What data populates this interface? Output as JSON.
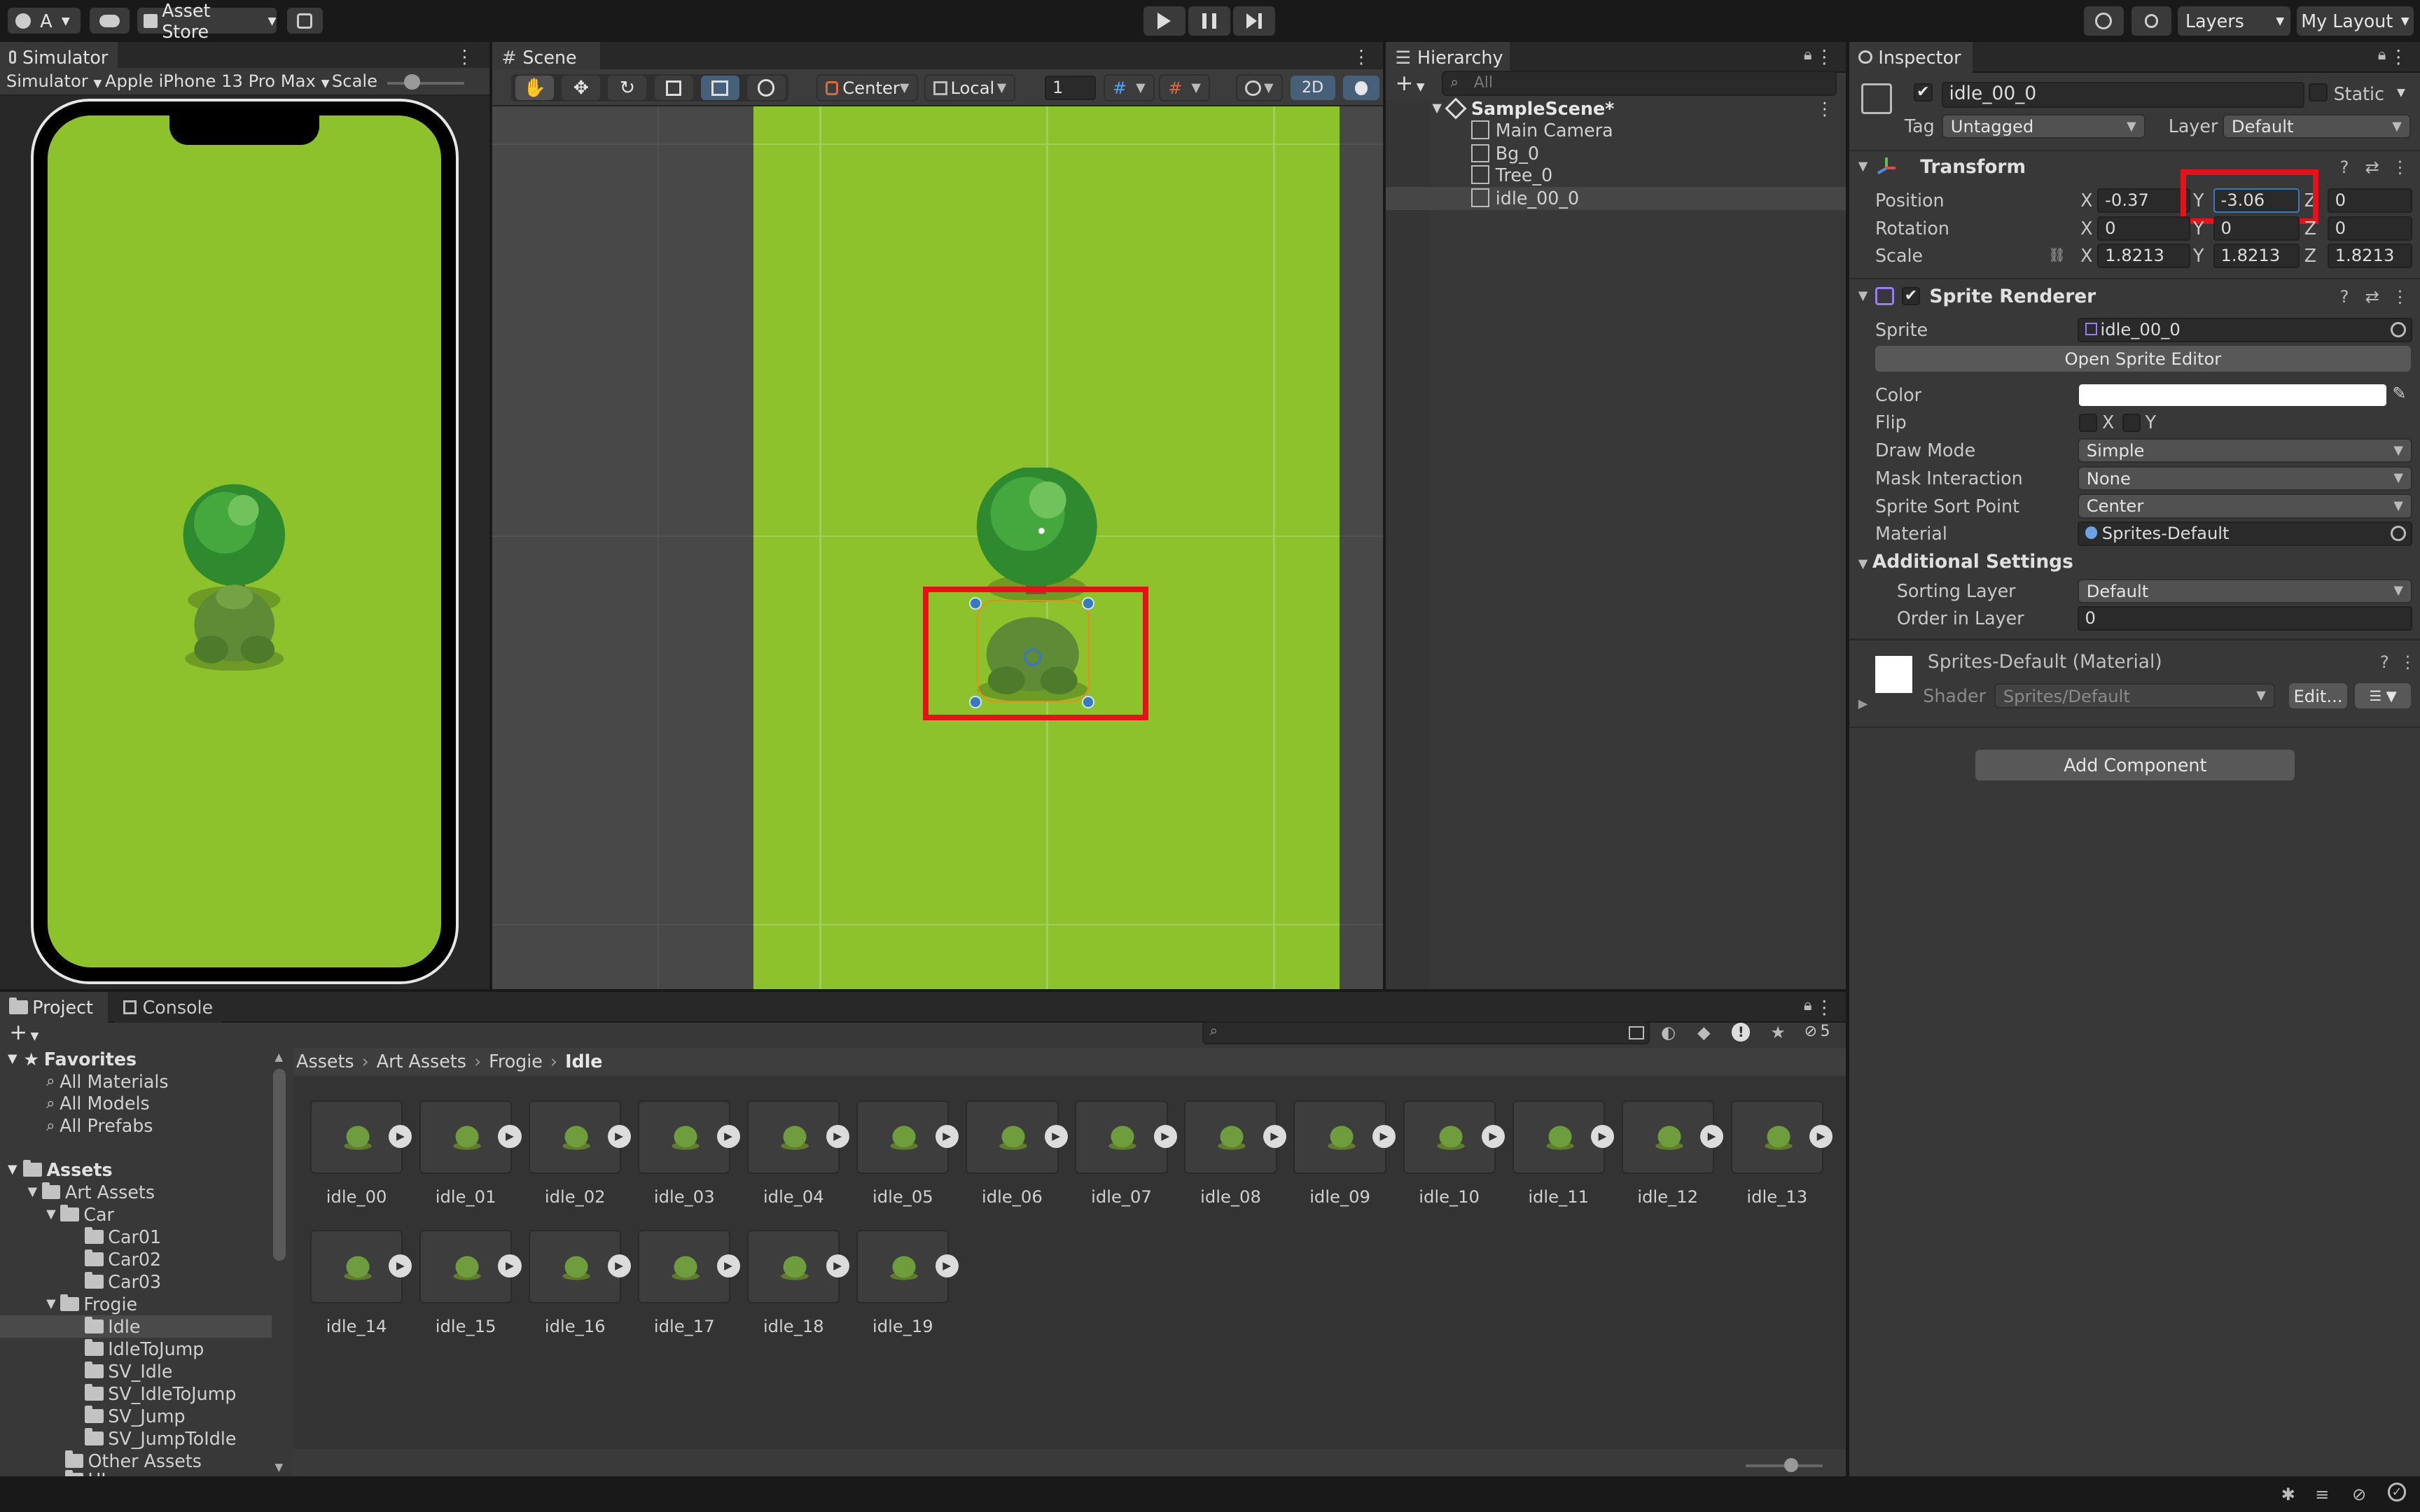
{
  "toolbar": {
    "account_label": "A",
    "asset_store_label": "Asset Store",
    "layers_label": "Layers",
    "layout_label": "My Layout"
  },
  "simulator": {
    "tab": "Simulator",
    "mode": "Simulator",
    "device": "Apple iPhone 13 Pro Max",
    "scale_label": "Scale"
  },
  "scene": {
    "tab": "Scene",
    "pivot": "Center",
    "space": "Local",
    "grid_snap": "1",
    "mode_2d": "2D"
  },
  "hierarchy": {
    "tab": "Hierarchy",
    "search_placeholder": "All",
    "scene_name": "SampleScene*",
    "items": [
      "Main Camera",
      "Bg_0",
      "Tree_0",
      "idle_00_0"
    ]
  },
  "inspector": {
    "tab": "Inspector",
    "object_name": "idle_00_0",
    "static_label": "Static",
    "tag_label": "Tag",
    "tag_value": "Untagged",
    "layer_label": "Layer",
    "layer_value": "Default",
    "transform": {
      "title": "Transform",
      "position_label": "Position",
      "rotation_label": "Rotation",
      "scale_label": "Scale",
      "x": "X",
      "y": "Y",
      "z": "Z",
      "position": [
        "-0.37",
        "-3.06",
        "0"
      ],
      "rotation": [
        "0",
        "0",
        "0"
      ],
      "scale": [
        "1.8213",
        "1.8213",
        "1.8213"
      ]
    },
    "sprite_renderer": {
      "title": "Sprite Renderer",
      "sprite_label": "Sprite",
      "sprite_value": "idle_00_0",
      "open_editor": "Open Sprite Editor",
      "color_label": "Color",
      "color_value": "#ffffff",
      "flip_label": "Flip",
      "flip_x": "X",
      "flip_y": "Y",
      "draw_mode_label": "Draw Mode",
      "draw_mode": "Simple",
      "mask_label": "Mask Interaction",
      "mask_value": "None",
      "sort_point_label": "Sprite Sort Point",
      "sort_point": "Center",
      "material_label": "Material",
      "material_value": "Sprites-Default",
      "additional": "Additional Settings",
      "sorting_layer_label": "Sorting Layer",
      "sorting_layer": "Default",
      "order_label": "Order in Layer",
      "order_value": "0"
    },
    "material": {
      "title": "Sprites-Default (Material)",
      "shader_label": "Shader",
      "shader_value": "Sprites/Default",
      "edit": "Edit..."
    },
    "add_component": "Add Component"
  },
  "project": {
    "tab_project": "Project",
    "tab_console": "Console",
    "hidden_count": "5",
    "breadcrumb": [
      "Assets",
      "Art Assets",
      "Frogie",
      "Idle"
    ],
    "favorites": {
      "title": "Favorites",
      "items": [
        "All Materials",
        "All Models",
        "All Prefabs"
      ]
    },
    "tree": {
      "assets": "Assets",
      "art_assets": "Art Assets",
      "car": "Car",
      "car_items": [
        "Car01",
        "Car02",
        "Car03"
      ],
      "frogie": "Frogie",
      "frogie_items": [
        "Idle",
        "IdleToJump",
        "SV_Idle",
        "SV_IdleToJump",
        "SV_Jump",
        "SV_JumpToIdle"
      ],
      "other_assets": "Other Assets",
      "cut_off": "UI"
    },
    "assets": [
      "idle_00",
      "idle_01",
      "idle_02",
      "idle_03",
      "idle_04",
      "idle_05",
      "idle_06",
      "idle_07",
      "idle_08",
      "idle_09",
      "idle_10",
      "idle_11",
      "idle_12",
      "idle_13",
      "idle_14",
      "idle_15",
      "idle_16",
      "idle_17",
      "idle_18",
      "idle_19"
    ]
  },
  "colors": {
    "grass": "#8dc22c",
    "highlight": "#e8101b",
    "accent": "#3a79bb"
  }
}
